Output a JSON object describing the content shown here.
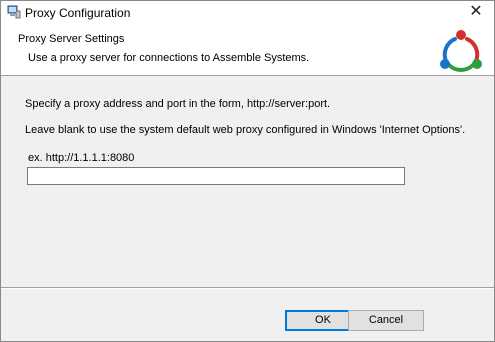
{
  "window": {
    "title": "Proxy Configuration",
    "close_glyph": "✕",
    "app_icon": "installer-computer-icon"
  },
  "header": {
    "title": "Proxy Server Settings",
    "subtitle": "Use a proxy server for connections to Assemble Systems.",
    "logo": "assemble-triangle-logo",
    "logo_colors": [
      "#1a73c9",
      "#d32f2f",
      "#2e9e3a"
    ]
  },
  "body": {
    "instruction_1": "Specify a proxy address and port in the form, http://server:port.",
    "instruction_2": "Leave blank to use the system default web proxy configured in Windows 'Internet Options'.",
    "example_label": "ex. http://1.1.1.1:8080"
  },
  "proxy_field": {
    "value": "",
    "placeholder": ""
  },
  "buttons": {
    "ok": "OK",
    "cancel": "Cancel"
  },
  "colors": {
    "dialog_bg": "#f0f0f0",
    "header_bg": "#ffffff",
    "focus_accent": "#0078d7"
  }
}
